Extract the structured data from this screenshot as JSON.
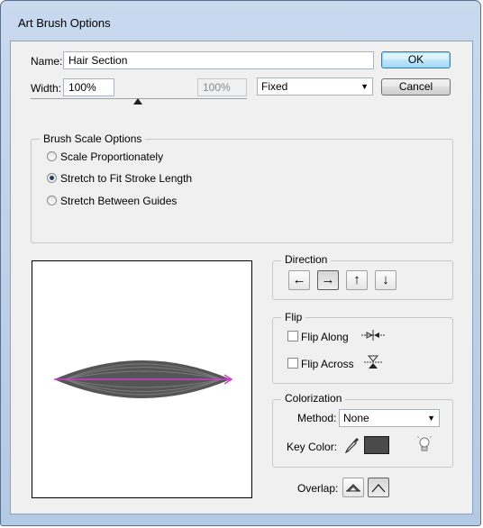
{
  "window": {
    "title": "Art Brush Options"
  },
  "name_row": {
    "label": "Name:",
    "value": "Hair Section"
  },
  "width_row": {
    "label": "Width:",
    "value": "100%",
    "secondary_value": "100%",
    "mode": "Fixed"
  },
  "buttons": {
    "ok": "OK",
    "cancel": "Cancel"
  },
  "scale_options": {
    "title": "Brush Scale Options",
    "options": [
      "Scale Proportionately",
      "Stretch to Fit Stroke Length",
      "Stretch Between Guides"
    ],
    "selected_index": 1
  },
  "direction": {
    "title": "Direction",
    "arrows": [
      "←",
      "→",
      "↑",
      "↓"
    ],
    "selected_index": 1
  },
  "flip": {
    "title": "Flip",
    "along": "Flip Along",
    "across": "Flip Across",
    "along_checked": false,
    "across_checked": false
  },
  "colorization": {
    "title": "Colorization",
    "method_label": "Method:",
    "method_value": "None",
    "key_color_label": "Key Color:",
    "key_color": "#4a4a4a"
  },
  "overlap": {
    "label": "Overlap:"
  },
  "colors": {
    "brush_fill": "#555555",
    "brush_stripes": "#7a7a7a",
    "path_line": "#d23bd2",
    "accent": "#3c7fb1"
  },
  "icons": [
    "eyedropper-icon",
    "lightbulb-tips-icon",
    "flip-along-icon",
    "flip-across-icon",
    "overlap-adjust-icon",
    "overlap-no-adjust-icon"
  ]
}
